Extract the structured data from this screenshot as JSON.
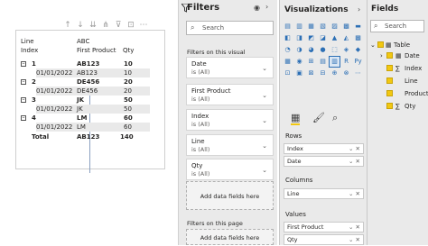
{
  "matrix": {
    "header": {
      "row_field_1": "Line",
      "row_field_2": "Index",
      "col_group": "ABC",
      "col_1": "First Product",
      "col_2": "Qty"
    },
    "rows": [
      {
        "label": "1",
        "product": "AB123",
        "qty": "10",
        "expander": "⊟",
        "sub": "01/01/2022",
        "sub_product": "AB123",
        "sub_qty": "10"
      },
      {
        "label": "2",
        "product": "DE456",
        "qty": "20",
        "expander": "⊟",
        "sub": "01/01/2022",
        "sub_product": "DE456",
        "sub_qty": "20"
      },
      {
        "label": "3",
        "product": "JK",
        "qty": "50",
        "expander": "⊟",
        "sub": "01/01/2022",
        "sub_product": "JK",
        "sub_qty": "50"
      },
      {
        "label": "4",
        "product": "LM",
        "qty": "60",
        "expander": "⊟",
        "sub": "01/01/2022",
        "sub_product": "LM",
        "sub_qty": "60"
      }
    ],
    "total": {
      "label": "Total",
      "product": "AB123",
      "qty": "140"
    }
  },
  "filters": {
    "title": "Filters",
    "search_placeholder": "Search",
    "on_this_visual": "Filters on this visual",
    "cards": [
      {
        "name": "Date",
        "value": "is (All)"
      },
      {
        "name": "First Product",
        "value": "is (All)"
      },
      {
        "name": "Index",
        "value": "is (All)"
      },
      {
        "name": "Line",
        "value": "is (All)"
      },
      {
        "name": "Qty",
        "value": "is (All)"
      }
    ],
    "add_data": "Add data fields here",
    "on_this_page": "Filters on this page",
    "add_data_page": "Add data fields here"
  },
  "visualizations": {
    "title": "Visualizations",
    "gallery": [
      "▤",
      "▥",
      "▦",
      "▧",
      "▨",
      "▩",
      "▬",
      "◧",
      "◨",
      "◩",
      "◪",
      "▲",
      "◭",
      "▩",
      "◔",
      "◑",
      "◕",
      "●",
      "⬚",
      "◈",
      "◆",
      "▦",
      "◉",
      "⊞",
      "▤",
      "▥",
      "R",
      "Py",
      "⊡",
      "▣",
      "⊠",
      "⊟",
      "⊕",
      "⊗",
      "⋯"
    ],
    "rows_label": "Rows",
    "rows_fields": [
      "Index",
      "Date"
    ],
    "columns_label": "Columns",
    "columns_fields": [
      "Line"
    ],
    "values_label": "Values",
    "values_fields": [
      "First Product",
      "Qty"
    ]
  },
  "fields": {
    "title": "Fields",
    "search_placeholder": "Search",
    "table_name": "Table",
    "items": [
      "Date",
      "Index",
      "Line",
      "Product",
      "Qty"
    ]
  }
}
